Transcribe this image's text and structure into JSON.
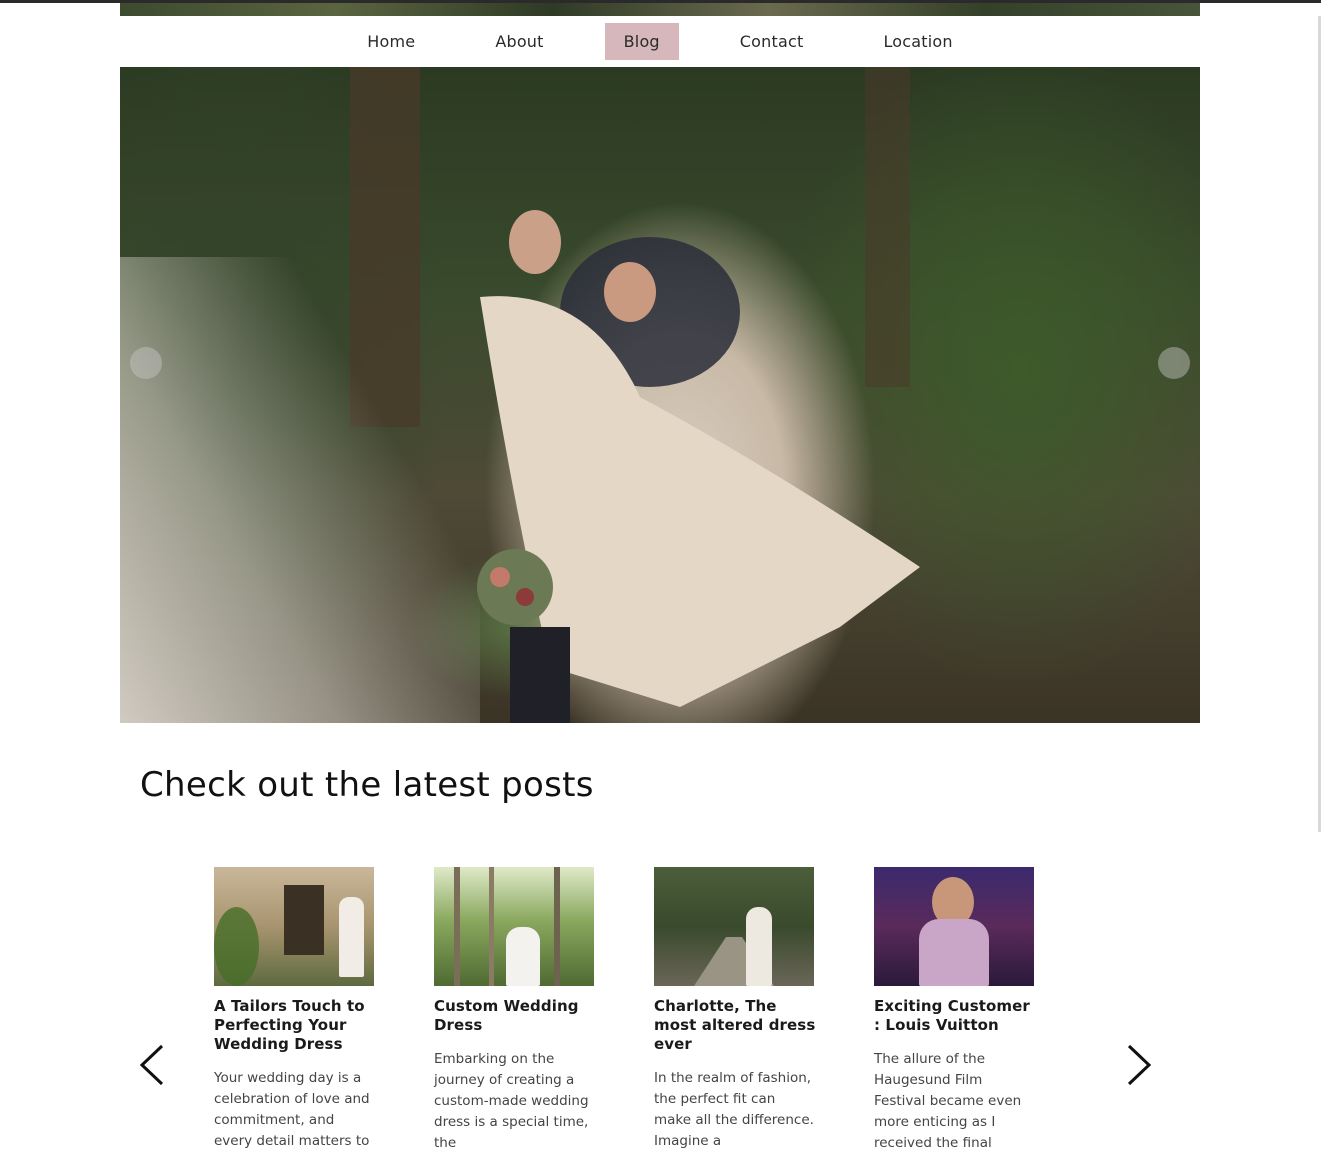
{
  "nav": {
    "items": [
      {
        "label": "Home"
      },
      {
        "label": "About"
      },
      {
        "label": "Blog",
        "active": true
      },
      {
        "label": "Contact"
      },
      {
        "label": "Location"
      }
    ],
    "active_color": "#d6b7bc"
  },
  "hero": {
    "image": "bride-groom-forest-photo"
  },
  "posts_section": {
    "title": "Check out the latest posts"
  },
  "posts": [
    {
      "title": "A Tailors Touch to Perfecting Your Wedding Dress",
      "excerpt": "Your wedding day is a celebration of love and commitment, and every detail matters to",
      "image": "couple-stone-doorway-photo"
    },
    {
      "title": "Custom Wedding Dress",
      "excerpt": "Embarking on the journey of creating a custom-made wedding dress is a special time, the",
      "image": "bride-in-birch-forest-photo"
    },
    {
      "title": "Charlotte, The most altered dress ever",
      "excerpt": "In the realm of fashion, the perfect fit can make all the difference. Imagine a",
      "image": "bride-on-forest-path-photo"
    },
    {
      "title": "Exciting Customer : Louis Vuitton",
      "excerpt": "The allure of the Haugesund Film Festival became even more enticing as I received the final",
      "image": "woman-on-stage-photo"
    }
  ]
}
